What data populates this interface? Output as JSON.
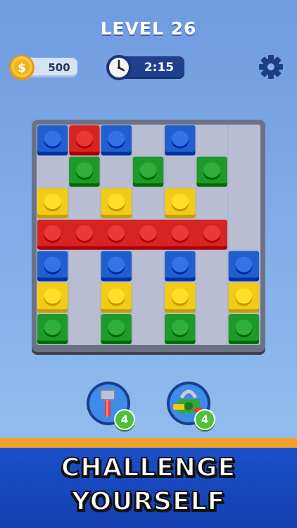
{
  "header": {
    "level_label": "LEVEL 26"
  },
  "currency": {
    "coins": "500",
    "icon": "coin-icon",
    "coin_symbol": "$"
  },
  "timer": {
    "value": "2:15",
    "icon": "clock-icon"
  },
  "settings": {
    "icon": "gear-icon"
  },
  "colors": {
    "blue": "#1f5fcf",
    "red": "#d92323",
    "green": "#1e9a2a",
    "yellow": "#f2cb16"
  },
  "board": {
    "cols": 7,
    "rows": 7,
    "blocks": [
      {
        "color": "blue",
        "col": 0,
        "row": 0,
        "w": 1
      },
      {
        "color": "red",
        "col": 1,
        "row": 0,
        "w": 1
      },
      {
        "color": "blue",
        "col": 2,
        "row": 0,
        "w": 1
      },
      {
        "color": "blue",
        "col": 4,
        "row": 0,
        "w": 1
      },
      {
        "color": "green",
        "col": 1,
        "row": 1,
        "w": 1
      },
      {
        "color": "green",
        "col": 3,
        "row": 1,
        "w": 1
      },
      {
        "color": "green",
        "col": 5,
        "row": 1,
        "w": 1
      },
      {
        "color": "yellow",
        "col": 0,
        "row": 2,
        "w": 1
      },
      {
        "color": "yellow",
        "col": 2,
        "row": 2,
        "w": 1
      },
      {
        "color": "yellow",
        "col": 4,
        "row": 2,
        "w": 1
      },
      {
        "color": "red",
        "col": 0,
        "row": 3,
        "w": 6
      },
      {
        "color": "blue",
        "col": 0,
        "row": 4,
        "w": 1
      },
      {
        "color": "blue",
        "col": 2,
        "row": 4,
        "w": 1
      },
      {
        "color": "blue",
        "col": 4,
        "row": 4,
        "w": 1
      },
      {
        "color": "blue",
        "col": 6,
        "row": 4,
        "w": 1
      },
      {
        "color": "yellow",
        "col": 0,
        "row": 5,
        "w": 1
      },
      {
        "color": "yellow",
        "col": 2,
        "row": 5,
        "w": 1
      },
      {
        "color": "yellow",
        "col": 4,
        "row": 5,
        "w": 1
      },
      {
        "color": "yellow",
        "col": 6,
        "row": 5,
        "w": 1
      },
      {
        "color": "green",
        "col": 0,
        "row": 6,
        "w": 1
      },
      {
        "color": "green",
        "col": 2,
        "row": 6,
        "w": 1
      },
      {
        "color": "green",
        "col": 4,
        "row": 6,
        "w": 1
      },
      {
        "color": "green",
        "col": 6,
        "row": 6,
        "w": 1
      }
    ]
  },
  "boosters": [
    {
      "name": "hammer-booster",
      "icon": "hammer-icon",
      "count": "4"
    },
    {
      "name": "unlock-booster",
      "icon": "unlock-block-icon",
      "count": "4"
    }
  ],
  "banner": {
    "line1": "CHALLENGE",
    "line2": "YOURSELF"
  }
}
